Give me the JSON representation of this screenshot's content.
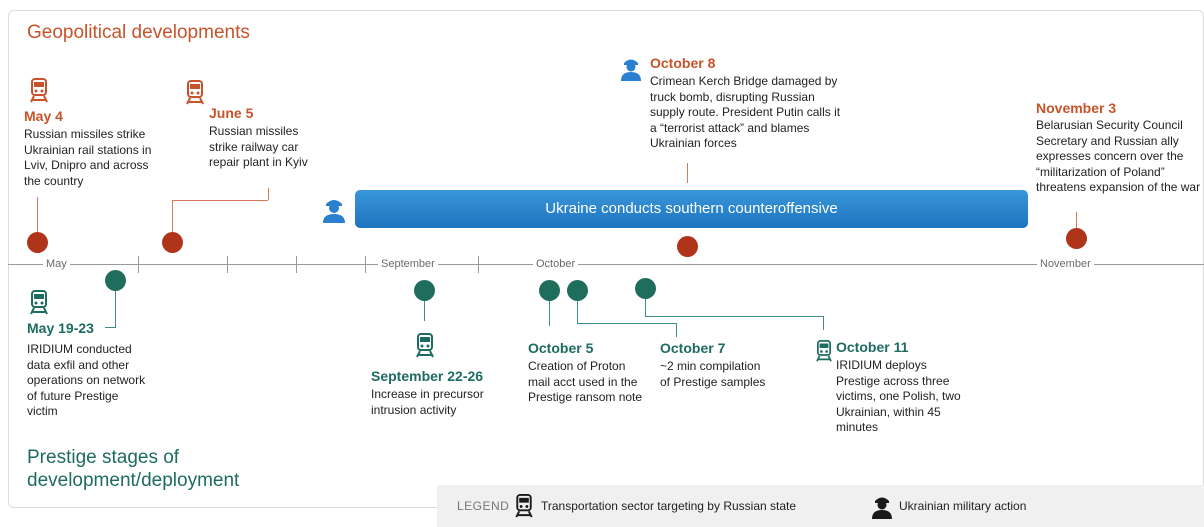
{
  "titles": {
    "geopolitical": "Geopolitical developments",
    "prestige": "Prestige stages of development/deployment"
  },
  "axis": {
    "months": [
      "May",
      "September",
      "October",
      "November"
    ]
  },
  "offensive_label": "Ukraine conducts southern counteroffensive",
  "geo_events": [
    {
      "date": "May 4",
      "desc": "Russian missiles strike Ukrainian rail stations in Lviv, Dnipro and across the country",
      "icon": "train-icon"
    },
    {
      "date": "June 5",
      "desc": "Russian missiles strike railway car repair plant in Kyiv",
      "icon": "train-icon"
    },
    {
      "date": "October 8",
      "desc": "Crimean Kerch Bridge damaged by truck bomb, disrupting Russian supply route. President Putin calls it a “terrorist attack” and blames Ukrainian forces",
      "icon": "soldier-icon"
    },
    {
      "date": "November 3",
      "desc": "Belarusian Security Council Secretary and Russian ally expresses concern over the “militarization of Poland” threatens expansion of the war"
    }
  ],
  "prestige_events": [
    {
      "date": "May 19-23",
      "desc": "IRIDIUM conducted data exfil and other operations on network of future Prestige victim",
      "icon": "train-icon"
    },
    {
      "date": "September 22-26",
      "desc": "Increase in precursor intrusion activity",
      "icon": "train-icon"
    },
    {
      "date": "October 5",
      "desc": "Creation of Proton mail acct used in the Prestige ransom note"
    },
    {
      "date": "October 7",
      "desc": "~2 min compilation of Prestige samples"
    },
    {
      "date": "October 11",
      "desc": "IRIDIUM deploys Prestige across three victims, one Polish, two Ukrainian, within 45 minutes",
      "icon": "train-icon"
    }
  ],
  "legend": {
    "label": "LEGEND",
    "items": [
      {
        "icon": "train-icon",
        "text": "Transportation sector targeting by Russian state"
      },
      {
        "icon": "soldier-icon",
        "text": "Ukrainian military action"
      }
    ]
  },
  "colors": {
    "geo": "#c8532a",
    "prestige": "#1e6b62",
    "offensive": "#2584cc",
    "red_dot": "#b0341a",
    "green_dot": "#1f6d5d"
  }
}
